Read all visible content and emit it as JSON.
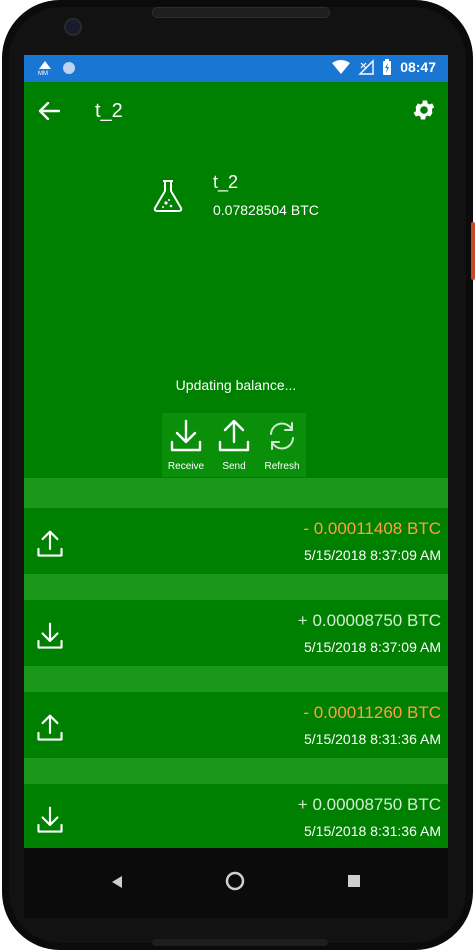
{
  "status_bar": {
    "time": "08:47",
    "icons": [
      "mm-notification-icon",
      "circle-notification-icon",
      "wifi-icon",
      "no-signal-icon",
      "battery-icon"
    ]
  },
  "app_bar": {
    "title": "t_2",
    "back_icon": "arrow-left-icon",
    "settings_icon": "gear-icon"
  },
  "wallet": {
    "icon": "flask-icon",
    "name": "t_2",
    "balance": "0.07828504 BTC"
  },
  "status_text": "Updating balance...",
  "actions": [
    {
      "label": "Receive",
      "icon": "download-icon"
    },
    {
      "label": "Send",
      "icon": "upload-icon"
    },
    {
      "label": "Refresh",
      "icon": "refresh-icon"
    }
  ],
  "transactions": [
    {
      "direction": "out",
      "icon": "upload-icon",
      "amount": "- 0.00011408 BTC",
      "date": "5/15/2018 8:37:09 AM"
    },
    {
      "direction": "in",
      "icon": "download-icon",
      "amount": "+ 0.00008750 BTC",
      "date": "5/15/2018 8:37:09 AM"
    },
    {
      "direction": "out",
      "icon": "upload-icon",
      "amount": "- 0.00011260 BTC",
      "date": "5/15/2018 8:31:36 AM"
    },
    {
      "direction": "in",
      "icon": "download-icon",
      "amount": "+ 0.00008750 BTC",
      "date": "5/15/2018 8:31:36 AM"
    }
  ],
  "colors": {
    "screen_bg": "#008000",
    "status_bar": "#1976d2",
    "outgoing_amount": "#ffa040",
    "incoming_amount": "#d0f0d0"
  },
  "nav_bar": {
    "back": "triangle-back-icon",
    "home": "circle-home-icon",
    "recents": "square-recents-icon"
  }
}
